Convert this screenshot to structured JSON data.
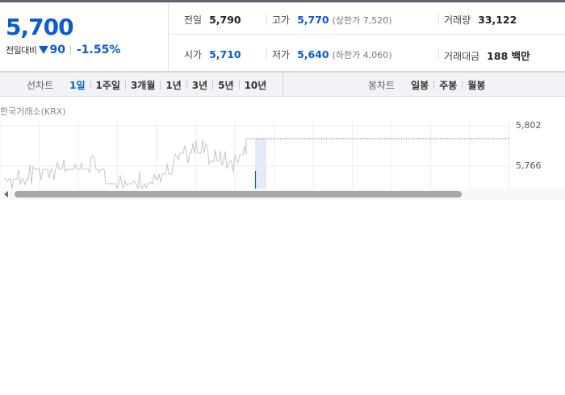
{
  "quote": {
    "price": "5,700",
    "change_label": "전일대비",
    "change_value": "90",
    "change_pct": "-1.55%",
    "direction": "down",
    "stats": {
      "prev_close": {
        "label": "전일",
        "value": "5,790"
      },
      "high": {
        "label": "고가",
        "value": "5,770",
        "sub": "(상한가 7,520)"
      },
      "volume": {
        "label": "거래량",
        "value": "33,122"
      },
      "open": {
        "label": "시가",
        "value": "5,710"
      },
      "low": {
        "label": "저가",
        "value": "5,640",
        "sub": "(하한가 4,060)"
      },
      "turnover": {
        "label": "거래대금",
        "value": "188 백만"
      }
    }
  },
  "tabs": {
    "line_label": "선차트",
    "line_items": [
      "1일",
      "1주일",
      "3개월",
      "1년",
      "3년",
      "5년",
      "10년"
    ],
    "line_active": 0,
    "candle_label": "봉차트",
    "candle_items": [
      "일봉",
      "주봉",
      "월봉"
    ]
  },
  "chart": {
    "source": "한국거래소(KRX)",
    "y_ticks": [
      "5,802",
      "5,766"
    ],
    "reference_line": 5802,
    "colors": {
      "line": "#c4c6cb",
      "accent": "#0b5bd1",
      "highlight": "#e3ebf8"
    }
  },
  "colors": {
    "up_down_blue": "#0b5bd1",
    "text": "#333333"
  }
}
